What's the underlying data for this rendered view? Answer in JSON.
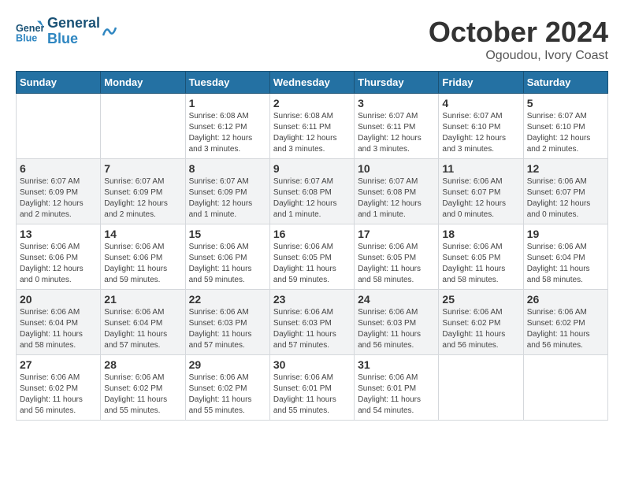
{
  "header": {
    "logo_line1": "General",
    "logo_line2": "Blue",
    "month": "October 2024",
    "location": "Ogoudou, Ivory Coast"
  },
  "days_of_week": [
    "Sunday",
    "Monday",
    "Tuesday",
    "Wednesday",
    "Thursday",
    "Friday",
    "Saturday"
  ],
  "weeks": [
    [
      {
        "day": "",
        "info": ""
      },
      {
        "day": "",
        "info": ""
      },
      {
        "day": "1",
        "info": "Sunrise: 6:08 AM\nSunset: 6:12 PM\nDaylight: 12 hours and 3 minutes."
      },
      {
        "day": "2",
        "info": "Sunrise: 6:08 AM\nSunset: 6:11 PM\nDaylight: 12 hours and 3 minutes."
      },
      {
        "day": "3",
        "info": "Sunrise: 6:07 AM\nSunset: 6:11 PM\nDaylight: 12 hours and 3 minutes."
      },
      {
        "day": "4",
        "info": "Sunrise: 6:07 AM\nSunset: 6:10 PM\nDaylight: 12 hours and 3 minutes."
      },
      {
        "day": "5",
        "info": "Sunrise: 6:07 AM\nSunset: 6:10 PM\nDaylight: 12 hours and 2 minutes."
      }
    ],
    [
      {
        "day": "6",
        "info": "Sunrise: 6:07 AM\nSunset: 6:09 PM\nDaylight: 12 hours and 2 minutes."
      },
      {
        "day": "7",
        "info": "Sunrise: 6:07 AM\nSunset: 6:09 PM\nDaylight: 12 hours and 2 minutes."
      },
      {
        "day": "8",
        "info": "Sunrise: 6:07 AM\nSunset: 6:09 PM\nDaylight: 12 hours and 1 minute."
      },
      {
        "day": "9",
        "info": "Sunrise: 6:07 AM\nSunset: 6:08 PM\nDaylight: 12 hours and 1 minute."
      },
      {
        "day": "10",
        "info": "Sunrise: 6:07 AM\nSunset: 6:08 PM\nDaylight: 12 hours and 1 minute."
      },
      {
        "day": "11",
        "info": "Sunrise: 6:06 AM\nSunset: 6:07 PM\nDaylight: 12 hours and 0 minutes."
      },
      {
        "day": "12",
        "info": "Sunrise: 6:06 AM\nSunset: 6:07 PM\nDaylight: 12 hours and 0 minutes."
      }
    ],
    [
      {
        "day": "13",
        "info": "Sunrise: 6:06 AM\nSunset: 6:06 PM\nDaylight: 12 hours and 0 minutes."
      },
      {
        "day": "14",
        "info": "Sunrise: 6:06 AM\nSunset: 6:06 PM\nDaylight: 11 hours and 59 minutes."
      },
      {
        "day": "15",
        "info": "Sunrise: 6:06 AM\nSunset: 6:06 PM\nDaylight: 11 hours and 59 minutes."
      },
      {
        "day": "16",
        "info": "Sunrise: 6:06 AM\nSunset: 6:05 PM\nDaylight: 11 hours and 59 minutes."
      },
      {
        "day": "17",
        "info": "Sunrise: 6:06 AM\nSunset: 6:05 PM\nDaylight: 11 hours and 58 minutes."
      },
      {
        "day": "18",
        "info": "Sunrise: 6:06 AM\nSunset: 6:05 PM\nDaylight: 11 hours and 58 minutes."
      },
      {
        "day": "19",
        "info": "Sunrise: 6:06 AM\nSunset: 6:04 PM\nDaylight: 11 hours and 58 minutes."
      }
    ],
    [
      {
        "day": "20",
        "info": "Sunrise: 6:06 AM\nSunset: 6:04 PM\nDaylight: 11 hours and 58 minutes."
      },
      {
        "day": "21",
        "info": "Sunrise: 6:06 AM\nSunset: 6:04 PM\nDaylight: 11 hours and 57 minutes."
      },
      {
        "day": "22",
        "info": "Sunrise: 6:06 AM\nSunset: 6:03 PM\nDaylight: 11 hours and 57 minutes."
      },
      {
        "day": "23",
        "info": "Sunrise: 6:06 AM\nSunset: 6:03 PM\nDaylight: 11 hours and 57 minutes."
      },
      {
        "day": "24",
        "info": "Sunrise: 6:06 AM\nSunset: 6:03 PM\nDaylight: 11 hours and 56 minutes."
      },
      {
        "day": "25",
        "info": "Sunrise: 6:06 AM\nSunset: 6:02 PM\nDaylight: 11 hours and 56 minutes."
      },
      {
        "day": "26",
        "info": "Sunrise: 6:06 AM\nSunset: 6:02 PM\nDaylight: 11 hours and 56 minutes."
      }
    ],
    [
      {
        "day": "27",
        "info": "Sunrise: 6:06 AM\nSunset: 6:02 PM\nDaylight: 11 hours and 56 minutes."
      },
      {
        "day": "28",
        "info": "Sunrise: 6:06 AM\nSunset: 6:02 PM\nDaylight: 11 hours and 55 minutes."
      },
      {
        "day": "29",
        "info": "Sunrise: 6:06 AM\nSunset: 6:02 PM\nDaylight: 11 hours and 55 minutes."
      },
      {
        "day": "30",
        "info": "Sunrise: 6:06 AM\nSunset: 6:01 PM\nDaylight: 11 hours and 55 minutes."
      },
      {
        "day": "31",
        "info": "Sunrise: 6:06 AM\nSunset: 6:01 PM\nDaylight: 11 hours and 54 minutes."
      },
      {
        "day": "",
        "info": ""
      },
      {
        "day": "",
        "info": ""
      }
    ]
  ]
}
